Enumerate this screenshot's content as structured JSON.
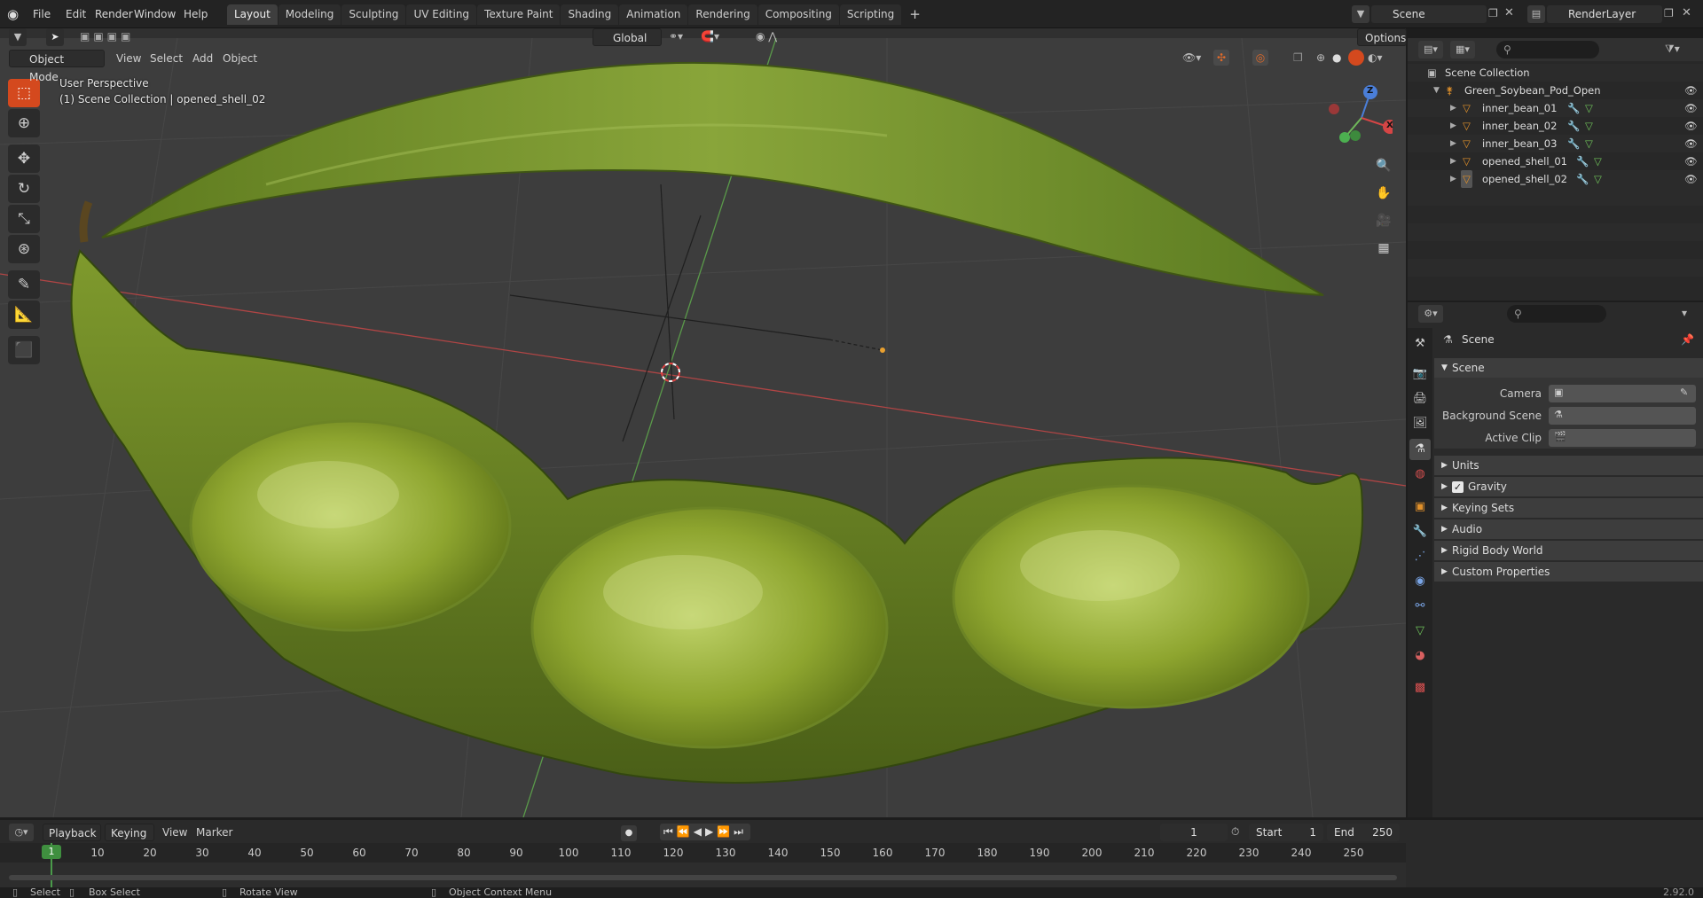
{
  "app": {
    "version": "2.92.0"
  },
  "menu": [
    "File",
    "Edit",
    "Render",
    "Window",
    "Help"
  ],
  "workspaces": [
    "Layout",
    "Modeling",
    "Sculpting",
    "UV Editing",
    "Texture Paint",
    "Shading",
    "Animation",
    "Rendering",
    "Compositing",
    "Scripting"
  ],
  "active_workspace": "Layout",
  "scene_field": "Scene",
  "view_layer_field": "RenderLayer",
  "viewport_header": {
    "mode": "Object Mode",
    "menus": [
      "View",
      "Select",
      "Add",
      "Object"
    ],
    "transform_orientation": "Global",
    "options_label": "Options"
  },
  "viewport_overlay": {
    "line1": "User Perspective",
    "line2": "(1) Scene Collection | opened_shell_02"
  },
  "gizmo_axes": {
    "x": "X",
    "y": "Y",
    "z": "Z"
  },
  "tools": [
    "select-box",
    "cursor",
    "move",
    "rotate",
    "scale",
    "transform",
    "annotate",
    "measure",
    "add-cube"
  ],
  "outliner": {
    "root": "Scene Collection",
    "collection": "Green_Soybean_Pod_Open",
    "items": [
      "inner_bean_01",
      "inner_bean_02",
      "inner_bean_03",
      "opened_shell_01",
      "opened_shell_02"
    ]
  },
  "properties": {
    "context_title": "Scene",
    "panel_scene": "Scene",
    "fields": [
      {
        "label": "Camera"
      },
      {
        "label": "Background Scene"
      },
      {
        "label": "Active Clip"
      }
    ],
    "panels": [
      "Units",
      "Gravity",
      "Keying Sets",
      "Audio",
      "Rigid Body World",
      "Custom Properties"
    ],
    "gravity_checked": true
  },
  "timeline": {
    "menus": [
      "Playback",
      "Keying",
      "View",
      "Marker"
    ],
    "current_frame": "1",
    "start_label": "Start",
    "start": "1",
    "end_label": "End",
    "end": "250",
    "ruler": [
      "1",
      "10",
      "20",
      "30",
      "40",
      "50",
      "60",
      "70",
      "80",
      "90",
      "100",
      "110",
      "120",
      "130",
      "140",
      "150",
      "160",
      "170",
      "180",
      "190",
      "200",
      "210",
      "220",
      "230",
      "240",
      "250"
    ]
  },
  "statusbar": {
    "select": "Select",
    "box_select": "Box Select",
    "rotate": "Rotate View",
    "context_menu": "Object Context Menu"
  },
  "colors": {
    "accent": "#4772b3",
    "active_tool": "#d4491e",
    "pod": "#8ca832",
    "x_axis": "#d04a4a",
    "y_axis": "#6fb65a"
  }
}
